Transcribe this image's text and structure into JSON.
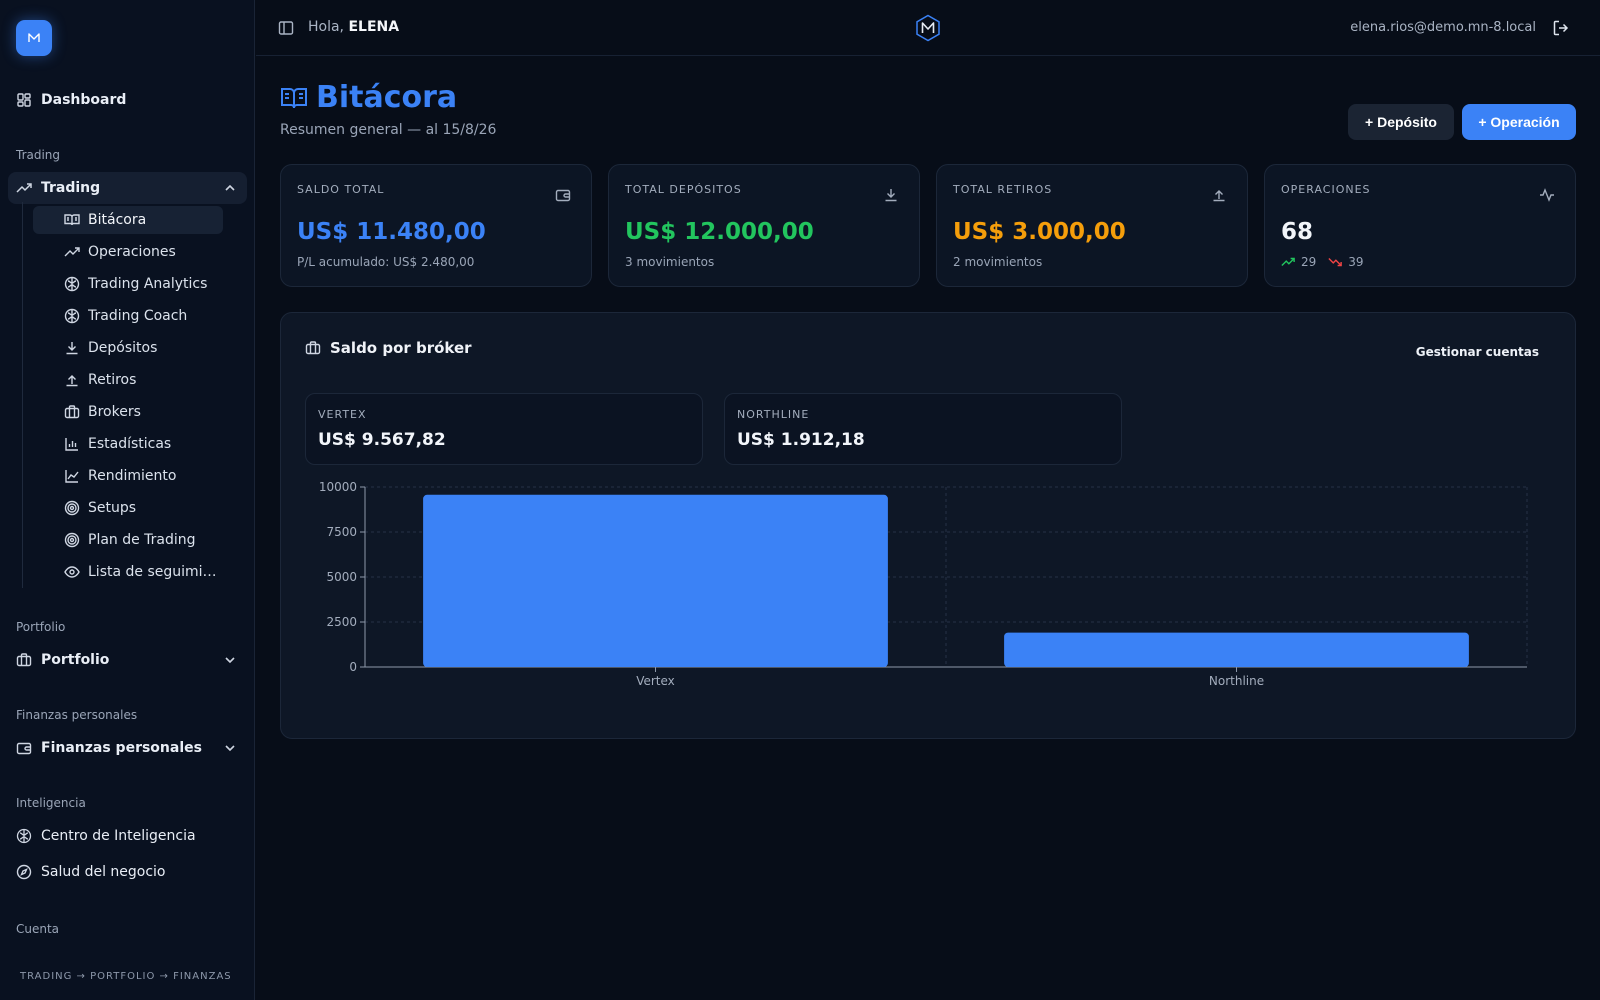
{
  "sidebar": {
    "logo_letter": "M",
    "dashboard": "Dashboard",
    "sections": {
      "trading": "Trading",
      "portfolio": "Portfolio",
      "finanzas": "Finanzas personales",
      "inteligencia": "Inteligencia",
      "cuenta": "Cuenta"
    },
    "trading_group": "Trading",
    "trading_items": [
      {
        "label": "Bitácora",
        "icon": "book-open-icon",
        "active": true
      },
      {
        "label": "Operaciones",
        "icon": "trending-up-icon"
      },
      {
        "label": "Trading Analytics",
        "icon": "brain-icon"
      },
      {
        "label": "Trading Coach",
        "icon": "brain-icon"
      },
      {
        "label": "Depósitos",
        "icon": "download-icon"
      },
      {
        "label": "Retiros",
        "icon": "upload-icon"
      },
      {
        "label": "Brokers",
        "icon": "briefcase-icon"
      },
      {
        "label": "Estadísticas",
        "icon": "bar-chart-icon"
      },
      {
        "label": "Rendimiento",
        "icon": "line-chart-icon"
      },
      {
        "label": "Setups",
        "icon": "target-icon"
      },
      {
        "label": "Plan de Trading",
        "icon": "target-icon"
      },
      {
        "label": "Lista de seguimiento",
        "icon": "eye-icon"
      }
    ],
    "portfolio_group": "Portfolio",
    "finanzas_group": "Finanzas personales",
    "intel_items": [
      {
        "label": "Centro de Inteligencia",
        "icon": "brain-icon"
      },
      {
        "label": "Salud del negocio",
        "icon": "compass-icon"
      }
    ],
    "footer": "TRADING → PORTFOLIO → FINANZAS"
  },
  "topbar": {
    "greeting": "Hola,",
    "user_name": "ELENA",
    "email": "elena.rios@demo.mn-8.local",
    "brand_letter": "M"
  },
  "page": {
    "title": "Bitácora",
    "subtitle": "Resumen general — al 15/8/26",
    "btn_deposit": "+ Depósito",
    "btn_operation": "+ Operación"
  },
  "stats": [
    {
      "label": "SALDO TOTAL",
      "value": "US$ 11.480,00",
      "note": "P/L acumulado: US$ 2.480,00",
      "color": "#3b82f6",
      "icon": "wallet-icon"
    },
    {
      "label": "TOTAL DEPÓSITOS",
      "value": "US$ 12.000,00",
      "note": "3 movimientos",
      "color": "#22c55e",
      "icon": "download-icon"
    },
    {
      "label": "TOTAL RETIROS",
      "value": "US$ 3.000,00",
      "note": "2 movimientos",
      "color": "#f59e0b",
      "icon": "upload-icon"
    },
    {
      "label": "OPERACIONES",
      "value": "68",
      "wins": "29",
      "losses": "39",
      "color": "#f2f5fa",
      "icon": "activity-icon"
    }
  ],
  "broker_panel": {
    "title": "Saldo por bróker",
    "manage": "Gestionar cuentas",
    "brokers": [
      {
        "name": "VERTEX",
        "value": "US$ 9.567,82"
      },
      {
        "name": "NORTHLINE",
        "value": "US$ 1.912,18"
      }
    ]
  },
  "chart_data": {
    "type": "bar",
    "categories": [
      "Vertex",
      "Northline"
    ],
    "values": [
      9567.82,
      1912.18
    ],
    "ylim": [
      0,
      10000
    ],
    "yticks": [
      0,
      2500,
      5000,
      7500,
      10000
    ],
    "grid": true,
    "bar_color": "#3b82f6",
    "title": "",
    "xlabel": "",
    "ylabel": ""
  }
}
